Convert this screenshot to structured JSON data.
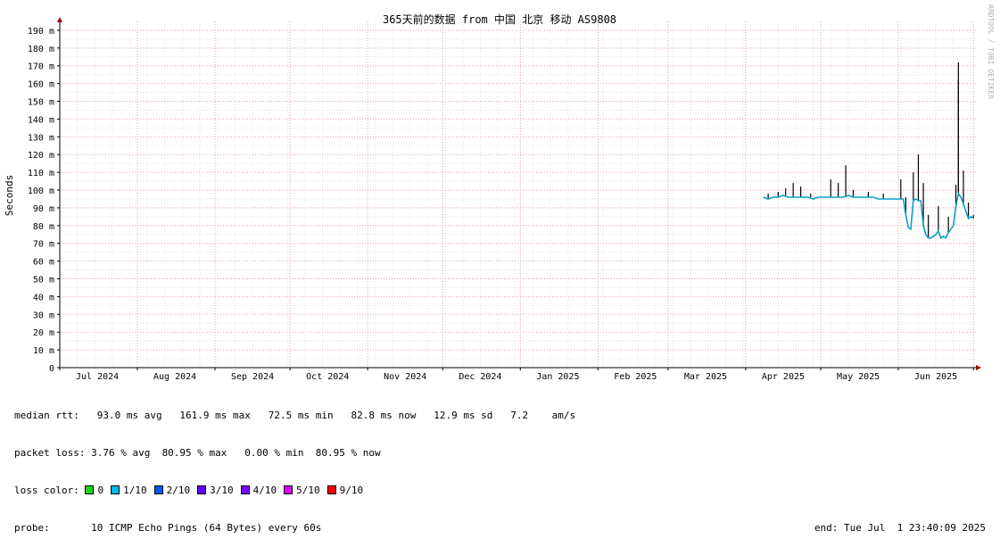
{
  "chart_data": {
    "type": "line",
    "title": "365天前的数据 from 中国 北京 移动 AS9808",
    "ylabel": "Seconds",
    "watermark": "RRDTOOL / TOBI OETIKER",
    "ylim": [
      0,
      195
    ],
    "xlim": [
      "2024-07-01",
      "2025-07-01"
    ],
    "y_ticks": [
      {
        "value": 0,
        "label": "0"
      },
      {
        "value": 10,
        "label": "10 m"
      },
      {
        "value": 20,
        "label": "20 m"
      },
      {
        "value": 30,
        "label": "30 m"
      },
      {
        "value": 40,
        "label": "40 m"
      },
      {
        "value": 50,
        "label": "50 m"
      },
      {
        "value": 60,
        "label": "60 m"
      },
      {
        "value": 70,
        "label": "70 m"
      },
      {
        "value": 80,
        "label": "80 m"
      },
      {
        "value": 90,
        "label": "90 m"
      },
      {
        "value": 100,
        "label": "100 m"
      },
      {
        "value": 110,
        "label": "110 m"
      },
      {
        "value": 120,
        "label": "120 m"
      },
      {
        "value": 130,
        "label": "130 m"
      },
      {
        "value": 140,
        "label": "140 m"
      },
      {
        "value": 150,
        "label": "150 m"
      },
      {
        "value": 160,
        "label": "160 m"
      },
      {
        "value": 170,
        "label": "170 m"
      },
      {
        "value": 180,
        "label": "180 m"
      },
      {
        "value": 190,
        "label": "190 m"
      }
    ],
    "x_ticks": [
      {
        "date": "2024-07-16",
        "label": "Jul 2024"
      },
      {
        "date": "2024-08-16",
        "label": "Aug 2024"
      },
      {
        "date": "2024-09-16",
        "label": "Sep 2024"
      },
      {
        "date": "2024-10-16",
        "label": "Oct 2024"
      },
      {
        "date": "2024-11-16",
        "label": "Nov 2024"
      },
      {
        "date": "2024-12-16",
        "label": "Dec 2024"
      },
      {
        "date": "2025-01-16",
        "label": "Jan 2025"
      },
      {
        "date": "2025-02-16",
        "label": "Feb 2025"
      },
      {
        "date": "2025-03-16",
        "label": "Mar 2025"
      },
      {
        "date": "2025-04-16",
        "label": "Apr 2025"
      },
      {
        "date": "2025-05-16",
        "label": "May 2025"
      },
      {
        "date": "2025-06-16",
        "label": "Jun 2025"
      }
    ],
    "month_starts": [
      "2024-07-01",
      "2024-08-01",
      "2024-09-01",
      "2024-10-01",
      "2024-11-01",
      "2024-12-01",
      "2025-01-01",
      "2025-02-01",
      "2025-03-01",
      "2025-04-01",
      "2025-05-01",
      "2025-06-01",
      "2025-07-01"
    ],
    "series": [
      {
        "kind": "median",
        "color": "#0aa0c8",
        "points": [
          [
            "2025-04-08",
            96
          ],
          [
            "2025-04-10",
            95
          ],
          [
            "2025-04-12",
            96
          ],
          [
            "2025-04-14",
            96
          ],
          [
            "2025-04-16",
            97
          ],
          [
            "2025-04-18",
            96
          ],
          [
            "2025-04-20",
            96
          ],
          [
            "2025-04-22",
            96
          ],
          [
            "2025-04-24",
            96
          ],
          [
            "2025-04-26",
            96
          ],
          [
            "2025-04-28",
            95
          ],
          [
            "2025-04-30",
            96
          ],
          [
            "2025-05-02",
            96
          ],
          [
            "2025-05-04",
            96
          ],
          [
            "2025-05-06",
            96
          ],
          [
            "2025-05-08",
            96
          ],
          [
            "2025-05-10",
            96
          ],
          [
            "2025-05-12",
            97
          ],
          [
            "2025-05-14",
            96
          ],
          [
            "2025-05-16",
            96
          ],
          [
            "2025-05-18",
            96
          ],
          [
            "2025-05-20",
            96
          ],
          [
            "2025-05-22",
            96
          ],
          [
            "2025-05-24",
            95
          ],
          [
            "2025-05-26",
            95
          ],
          [
            "2025-05-28",
            95
          ],
          [
            "2025-05-30",
            95
          ],
          [
            "2025-06-01",
            95
          ],
          [
            "2025-06-03",
            95
          ],
          [
            "2025-06-04",
            86
          ],
          [
            "2025-06-05",
            79
          ],
          [
            "2025-06-06",
            78
          ],
          [
            "2025-06-07",
            94
          ],
          [
            "2025-06-08",
            95
          ],
          [
            "2025-06-09",
            94
          ],
          [
            "2025-06-10",
            94
          ],
          [
            "2025-06-11",
            80
          ],
          [
            "2025-06-12",
            75
          ],
          [
            "2025-06-13",
            73
          ],
          [
            "2025-06-14",
            73
          ],
          [
            "2025-06-15",
            74
          ],
          [
            "2025-06-16",
            75
          ],
          [
            "2025-06-17",
            77
          ],
          [
            "2025-06-18",
            73
          ],
          [
            "2025-06-19",
            74
          ],
          [
            "2025-06-20",
            73
          ],
          [
            "2025-06-21",
            76
          ],
          [
            "2025-06-22",
            78
          ],
          [
            "2025-06-23",
            80
          ],
          [
            "2025-06-24",
            91
          ],
          [
            "2025-06-25",
            98
          ],
          [
            "2025-06-26",
            96
          ],
          [
            "2025-06-27",
            92
          ],
          [
            "2025-06-28",
            88
          ],
          [
            "2025-06-29",
            84
          ],
          [
            "2025-06-30",
            85
          ],
          [
            "2025-07-01",
            84
          ]
        ]
      },
      {
        "kind": "max",
        "color": "#000000",
        "points": [
          [
            "2025-04-10",
            98
          ],
          [
            "2025-04-14",
            99
          ],
          [
            "2025-04-17",
            101
          ],
          [
            "2025-04-20",
            104
          ],
          [
            "2025-04-23",
            102
          ],
          [
            "2025-04-27",
            98
          ],
          [
            "2025-05-05",
            106
          ],
          [
            "2025-05-08",
            104
          ],
          [
            "2025-05-11",
            114
          ],
          [
            "2025-05-14",
            100
          ],
          [
            "2025-05-20",
            99
          ],
          [
            "2025-05-26",
            98
          ],
          [
            "2025-06-02",
            106
          ],
          [
            "2025-06-04",
            96
          ],
          [
            "2025-06-07",
            110
          ],
          [
            "2025-06-09",
            120
          ],
          [
            "2025-06-11",
            104
          ],
          [
            "2025-06-13",
            86
          ],
          [
            "2025-06-17",
            91
          ],
          [
            "2025-06-21",
            85
          ],
          [
            "2025-06-24",
            103
          ],
          [
            "2025-06-25",
            162
          ],
          [
            "2025-06-25",
            172
          ],
          [
            "2025-06-27",
            111
          ],
          [
            "2025-06-29",
            93
          ],
          [
            "2025-07-01",
            86
          ]
        ]
      }
    ]
  },
  "legend": {
    "median_rtt": "median rtt:   93.0 ms avg   161.9 ms max   72.5 ms min   82.8 ms now   12.9 ms sd   7.2    am/s",
    "packet_loss": "packet loss: 3.76 % avg  80.95 % max   0.00 % min  80.95 % now",
    "loss_color_label": "loss color: ",
    "loss_colors": [
      {
        "label": "0",
        "color": "#26d126"
      },
      {
        "label": "1/10",
        "color": "#00b8e8"
      },
      {
        "label": "2/10",
        "color": "#0059ff"
      },
      {
        "label": "3/10",
        "color": "#5e00ff"
      },
      {
        "label": "4/10",
        "color": "#7e00ff"
      },
      {
        "label": "5/10",
        "color": "#dd00ff"
      },
      {
        "label": "9/10",
        "color": "#ff0000"
      }
    ],
    "probe": "probe:       10 ICMP Echo Pings (64 Bytes) every 60s",
    "end": "end: Tue Jul  1 23:40:09 2025"
  }
}
